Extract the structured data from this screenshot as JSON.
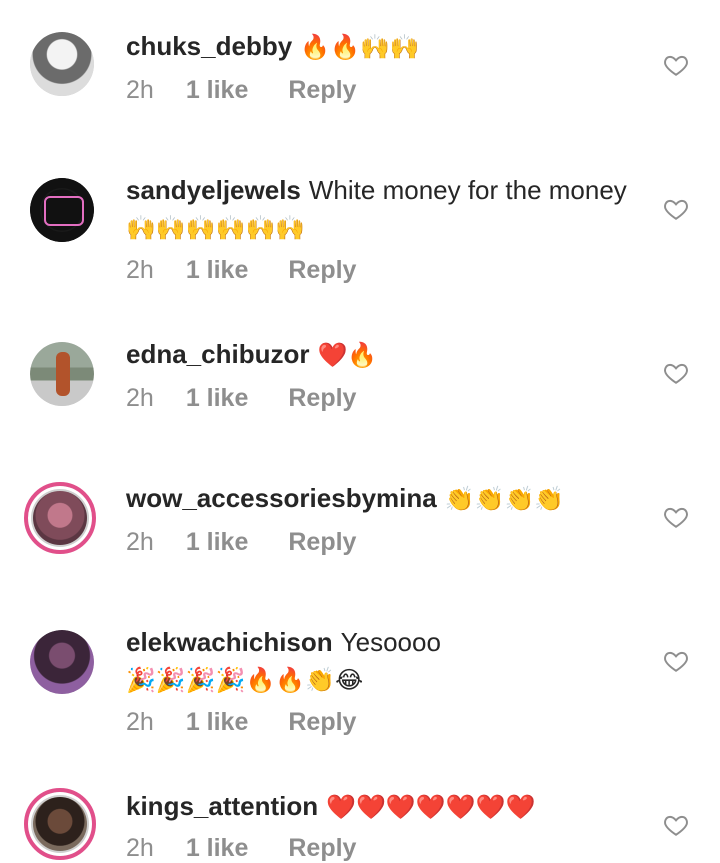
{
  "comments": [
    {
      "username": "chuks_debby",
      "text": "",
      "emoji": "🔥🔥🙌🙌",
      "time": "2h",
      "likes": "1 like",
      "reply": "Reply"
    },
    {
      "username": "sandyeljewels",
      "text": "White money for the money",
      "emoji": "🙌🙌🙌🙌🙌🙌",
      "time": "2h",
      "likes": "1 like",
      "reply": "Reply"
    },
    {
      "username": "edna_chibuzor",
      "text": "",
      "emoji": "❤️🔥",
      "time": "2h",
      "likes": "1 like",
      "reply": "Reply"
    },
    {
      "username": "wow_accessoriesbymina",
      "text": "",
      "emoji": "👏👏👏👏",
      "time": "2h",
      "likes": "1 like",
      "reply": "Reply"
    },
    {
      "username": "elekwachichison",
      "text": "Yesoooo",
      "emoji": "🎉🎉🎉🎉🔥🔥👏😂",
      "time": "2h",
      "likes": "1 like",
      "reply": "Reply"
    },
    {
      "username": "kings_attention",
      "text": "",
      "emoji": "❤️❤️❤️❤️❤️❤️❤️",
      "time": "2h",
      "likes": "1 like",
      "reply": "Reply"
    }
  ],
  "colors": {
    "meta": "#8e8e8e",
    "text": "#262626",
    "ring": "#e14f8a"
  }
}
